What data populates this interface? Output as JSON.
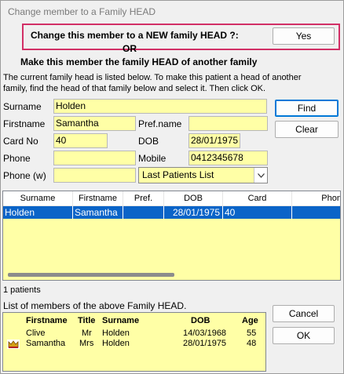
{
  "window": {
    "title": "Change member to a Family HEAD"
  },
  "prompt": {
    "question": "Change this member to a NEW family HEAD ?:",
    "yes_label": "Yes",
    "or_label": "OR",
    "heading": "Make this member the family HEAD of another family",
    "instructions": "The current family head is listed below. To make this patient a head of another family, find the head of that family below and select it. Then click OK."
  },
  "search": {
    "surname_label": "Surname",
    "surname_value": "Holden",
    "firstname_label": "Firstname",
    "firstname_value": "Samantha",
    "prefname_label": "Pref.name",
    "prefname_value": "",
    "cardno_label": "Card No",
    "cardno_value": "40",
    "dob_label": "DOB",
    "dob_value": "28/01/1975",
    "phone_label": "Phone",
    "phone_value": "",
    "mobile_label": "Mobile",
    "mobile_value": "0412345678",
    "phonew_label": "Phone (w)",
    "phonew_value": "",
    "list_select": "Last Patients List",
    "find_label": "Find",
    "clear_label": "Clear"
  },
  "results": {
    "columns": [
      "Surname",
      "Firstname",
      "Pref.",
      "DOB",
      "Card",
      "Phon"
    ],
    "rows": [
      {
        "surname": "Holden",
        "firstname": "Samantha",
        "pref": "",
        "dob": "28/01/1975",
        "card": "40",
        "phone": ""
      }
    ],
    "count_text": "1 patients"
  },
  "members": {
    "caption": "List of members of the above Family HEAD.",
    "columns": {
      "firstname": "Firstname",
      "title": "Title",
      "surname": "Surname",
      "dob": "DOB",
      "age": "Age"
    },
    "rows": [
      {
        "firstname": "Clive",
        "title": "Mr",
        "surname": "Holden",
        "dob": "14/03/1968",
        "age": "55",
        "head": false
      },
      {
        "firstname": "Samantha",
        "title": "Mrs",
        "surname": "Holden",
        "dob": "28/01/1975",
        "age": "48",
        "head": true
      }
    ],
    "icon": "crown-icon",
    "cancel_label": "Cancel",
    "ok_label": "OK"
  },
  "colors": {
    "field_bg": "#ffffa6",
    "highlight_border": "#d22f66",
    "selection": "#0a64c8"
  }
}
